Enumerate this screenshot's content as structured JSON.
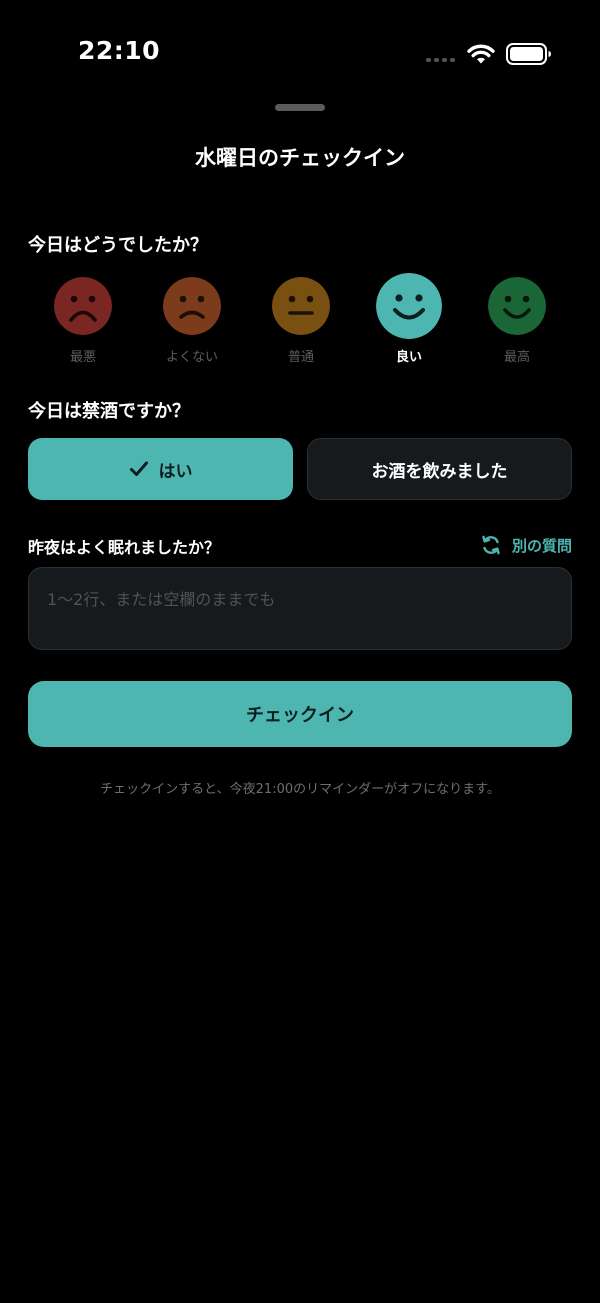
{
  "status_bar": {
    "time": "22:10",
    "wifi_icon": "wifi-icon",
    "battery_icon": "battery-icon"
  },
  "sheet": {
    "title": "水曜日のチェックイン"
  },
  "mood_section": {
    "question": "今日はどうでしたか？",
    "selected": "良い",
    "options": [
      {
        "label": "最悪",
        "icon": "very-sad-face-icon",
        "color": "#7a2723"
      },
      {
        "label": "よくない",
        "icon": "sad-face-icon",
        "color": "#7c3c1c"
      },
      {
        "label": "普通",
        "icon": "neutral-face-icon",
        "color": "#7a5012"
      },
      {
        "label": "良い",
        "icon": "smile-face-icon",
        "color": "#4db6b0"
      },
      {
        "label": "最高",
        "icon": "happy-face-icon",
        "color": "#1b6636"
      }
    ]
  },
  "sobriety_section": {
    "question": "今日は禁酒ですか？",
    "yes_label": "はい",
    "no_label": "お酒を飲みました",
    "selected": "はい"
  },
  "sleep_section": {
    "question": "昨夜はよく眠れましたか？",
    "alt_question_label": "別の質問",
    "input_value": "",
    "input_placeholder": "1〜2行、または空欄のままでも"
  },
  "checkin_button_label": "チェックイン",
  "footer_note": "チェックインすると、今夜21:00のリマインダーがオフになります。",
  "colors": {
    "accent": "#4db6b0",
    "background": "#000000",
    "surface": "#161a1c",
    "border": "#2b3033"
  }
}
